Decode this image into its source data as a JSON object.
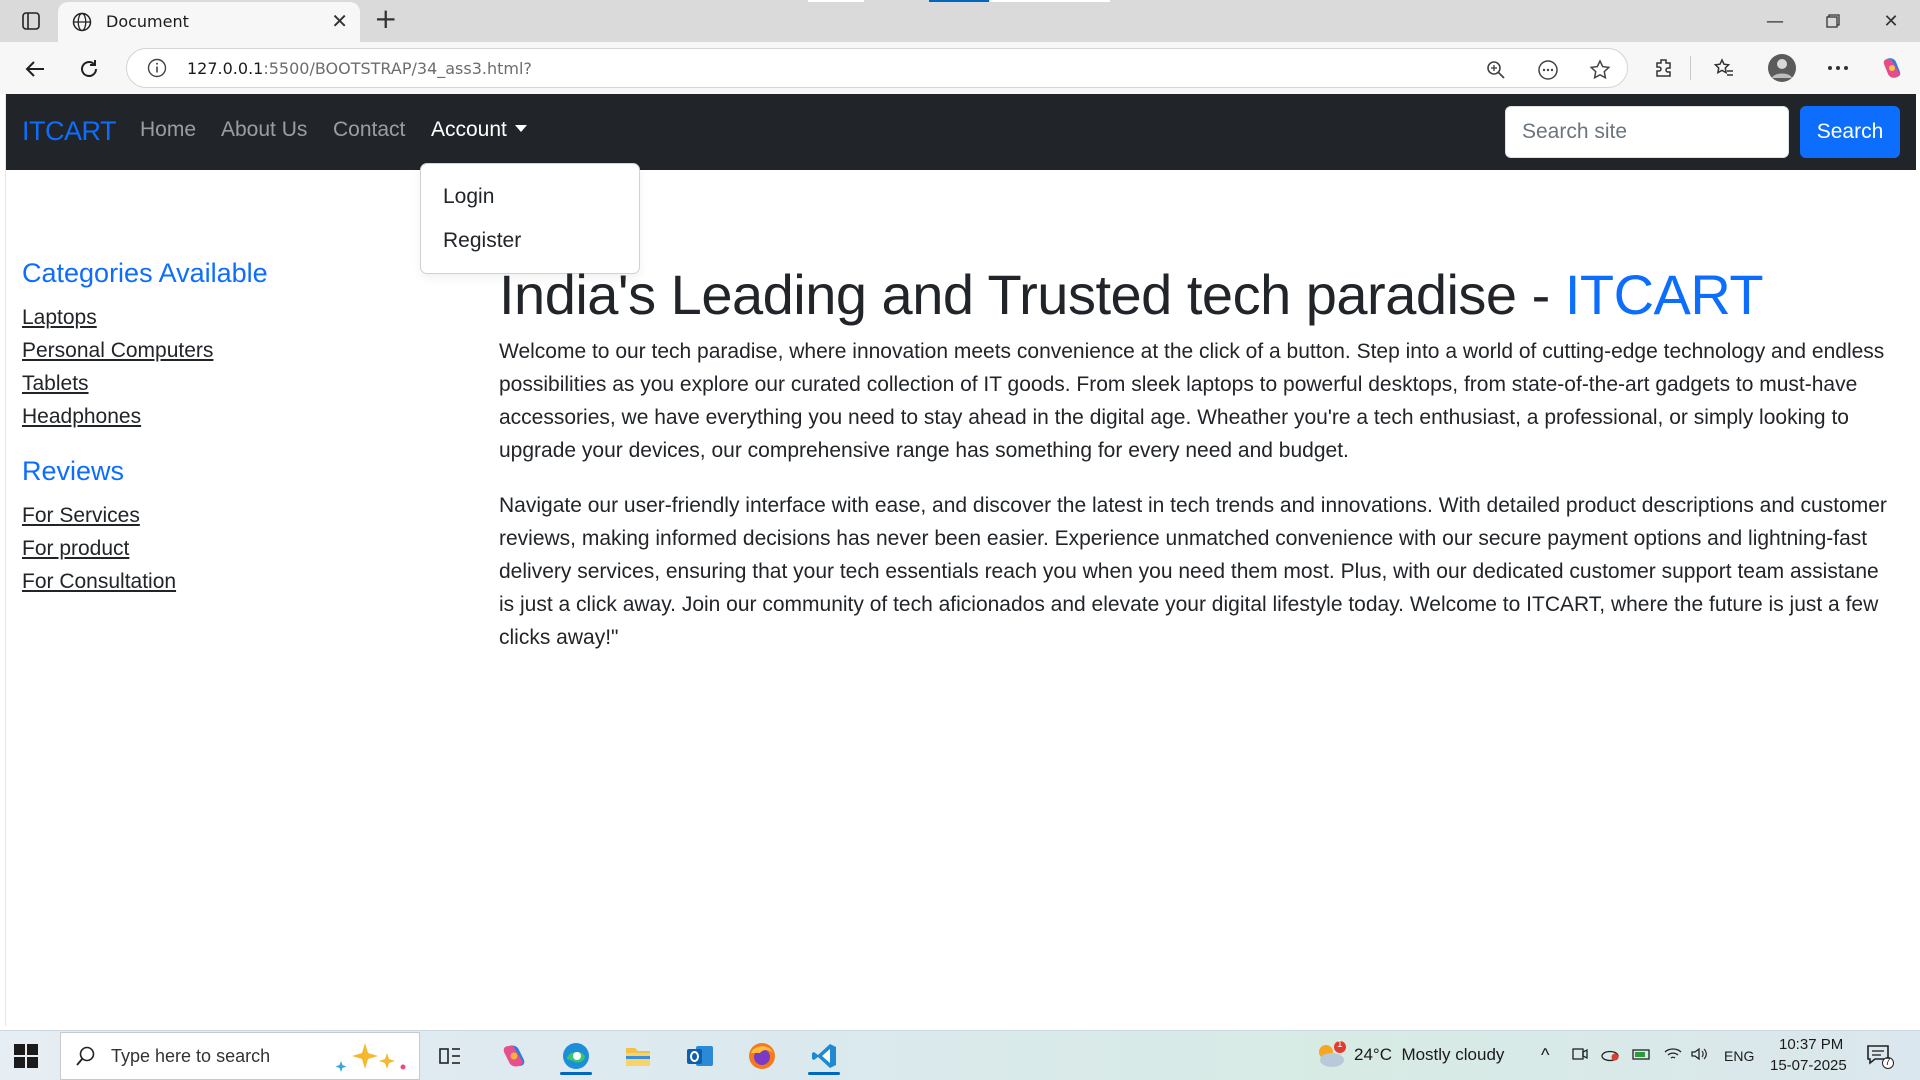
{
  "browser": {
    "tab_title": "Document",
    "url_host": "127.0.0.1",
    "url_path": ":5500/BOOTSTRAP/34_ass3.html?"
  },
  "navbar": {
    "brand": "ITCART",
    "links": [
      "Home",
      "About Us",
      "Contact"
    ],
    "account_label": "Account",
    "search_placeholder": "Search site",
    "search_button": "Search"
  },
  "dropdown": {
    "items": [
      "Login",
      "Register"
    ]
  },
  "sidebar": {
    "categories_heading": "Categories Available",
    "categories": [
      "Laptops",
      "Personal Computers",
      "Tablets",
      "Headphones"
    ],
    "reviews_heading": "Reviews",
    "reviews": [
      "For Services",
      "For product",
      "For Consultation"
    ]
  },
  "main": {
    "heading": "India's Leading and Trusted tech paradise - ",
    "heading_accent": "ITCART",
    "paragraph1": "Welcome to our tech paradise, where innovation meets convenience at the click of a button. Step into a world of cutting-edge technology and endless possibilities as you explore our curated collection of IT goods. From sleek laptops to powerful desktops, from state-of-the-art gadgets to must-have accessories, we have everything you need to stay ahead in the digital age. Wheather you're a tech enthusiast, a professional, or simply looking to upgrade your devices, our comprehensive range has something for every need and budget.",
    "paragraph2": "Navigate our user-friendly interface with ease, and discover the latest in tech trends and innovations. With detailed product descriptions and customer reviews, making informed decisions has never been easier. Experience unmatched convenience with our secure payment options and lightning-fast delivery services, ensuring that your tech essentials reach you when you need them most. Plus, with our dedicated customer support team assistane is just a click away. Join our community of tech aficionados and elevate your digital lifestyle today. Welcome to ITCART, where the future is just a few clicks away!\""
  },
  "taskbar": {
    "search_placeholder": "Type here to search",
    "weather_temp": "24°C",
    "weather_desc": "Mostly cloudy",
    "weather_badge": "1",
    "language": "ENG",
    "time": "10:37 PM",
    "date": "15-07-2025",
    "notification_count": "7"
  },
  "colors": {
    "navbar_bg": "#212529",
    "primary": "#0d6efd",
    "text": "#212529"
  }
}
